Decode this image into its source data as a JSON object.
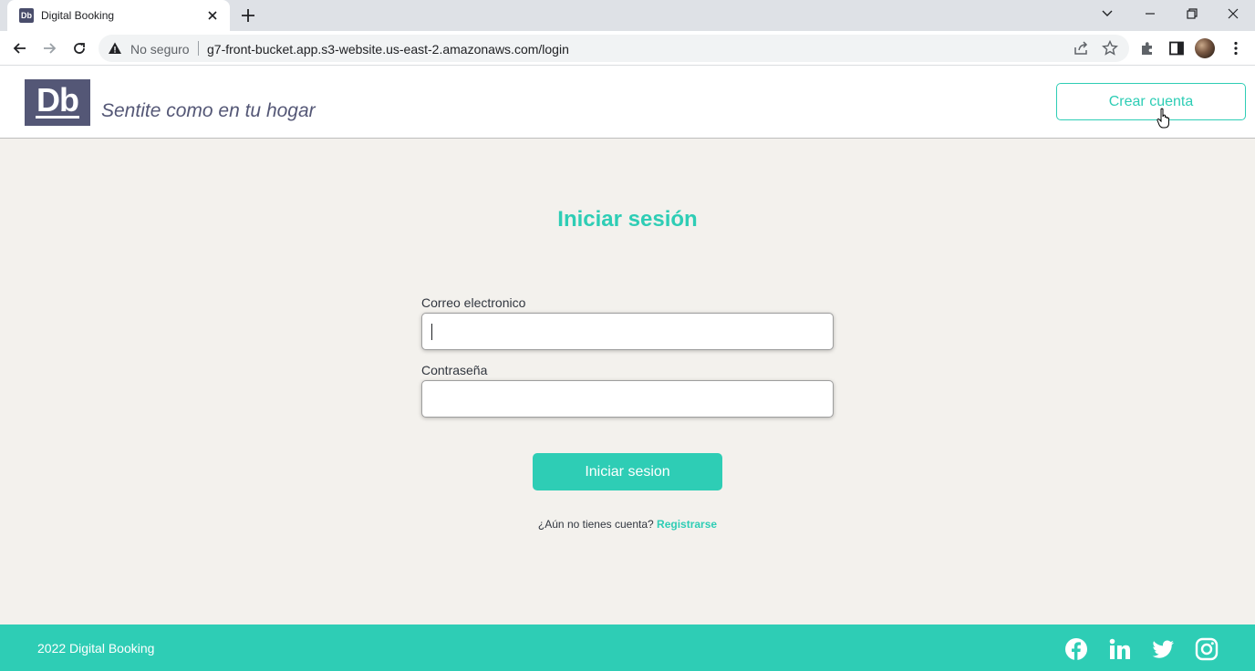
{
  "browser": {
    "tab_title": "Digital Booking",
    "tab_favicon_text": "Db",
    "security_label": "No seguro",
    "url": "g7-front-bucket.app.s3-website.us-east-2.amazonaws.com/login"
  },
  "header": {
    "logo_text": "Db",
    "slogan": "Sentite como en tu hogar",
    "create_account_label": "Crear cuenta"
  },
  "login": {
    "title": "Iniciar sesión",
    "email_label": "Correo electronico",
    "email_value": "",
    "password_label": "Contraseña",
    "password_value": "",
    "submit_label": "Iniciar sesion",
    "no_account_text": "¿Aún no tienes cuenta?",
    "register_link": "Registrarse"
  },
  "footer": {
    "copyright": "2022 Digital Booking",
    "social_icons": [
      "facebook-icon",
      "linkedin-icon",
      "twitter-icon",
      "instagram-icon"
    ]
  },
  "colors": {
    "primary": "#2ecdb5",
    "brand_dark": "#545776",
    "background": "#f3f1ed"
  }
}
